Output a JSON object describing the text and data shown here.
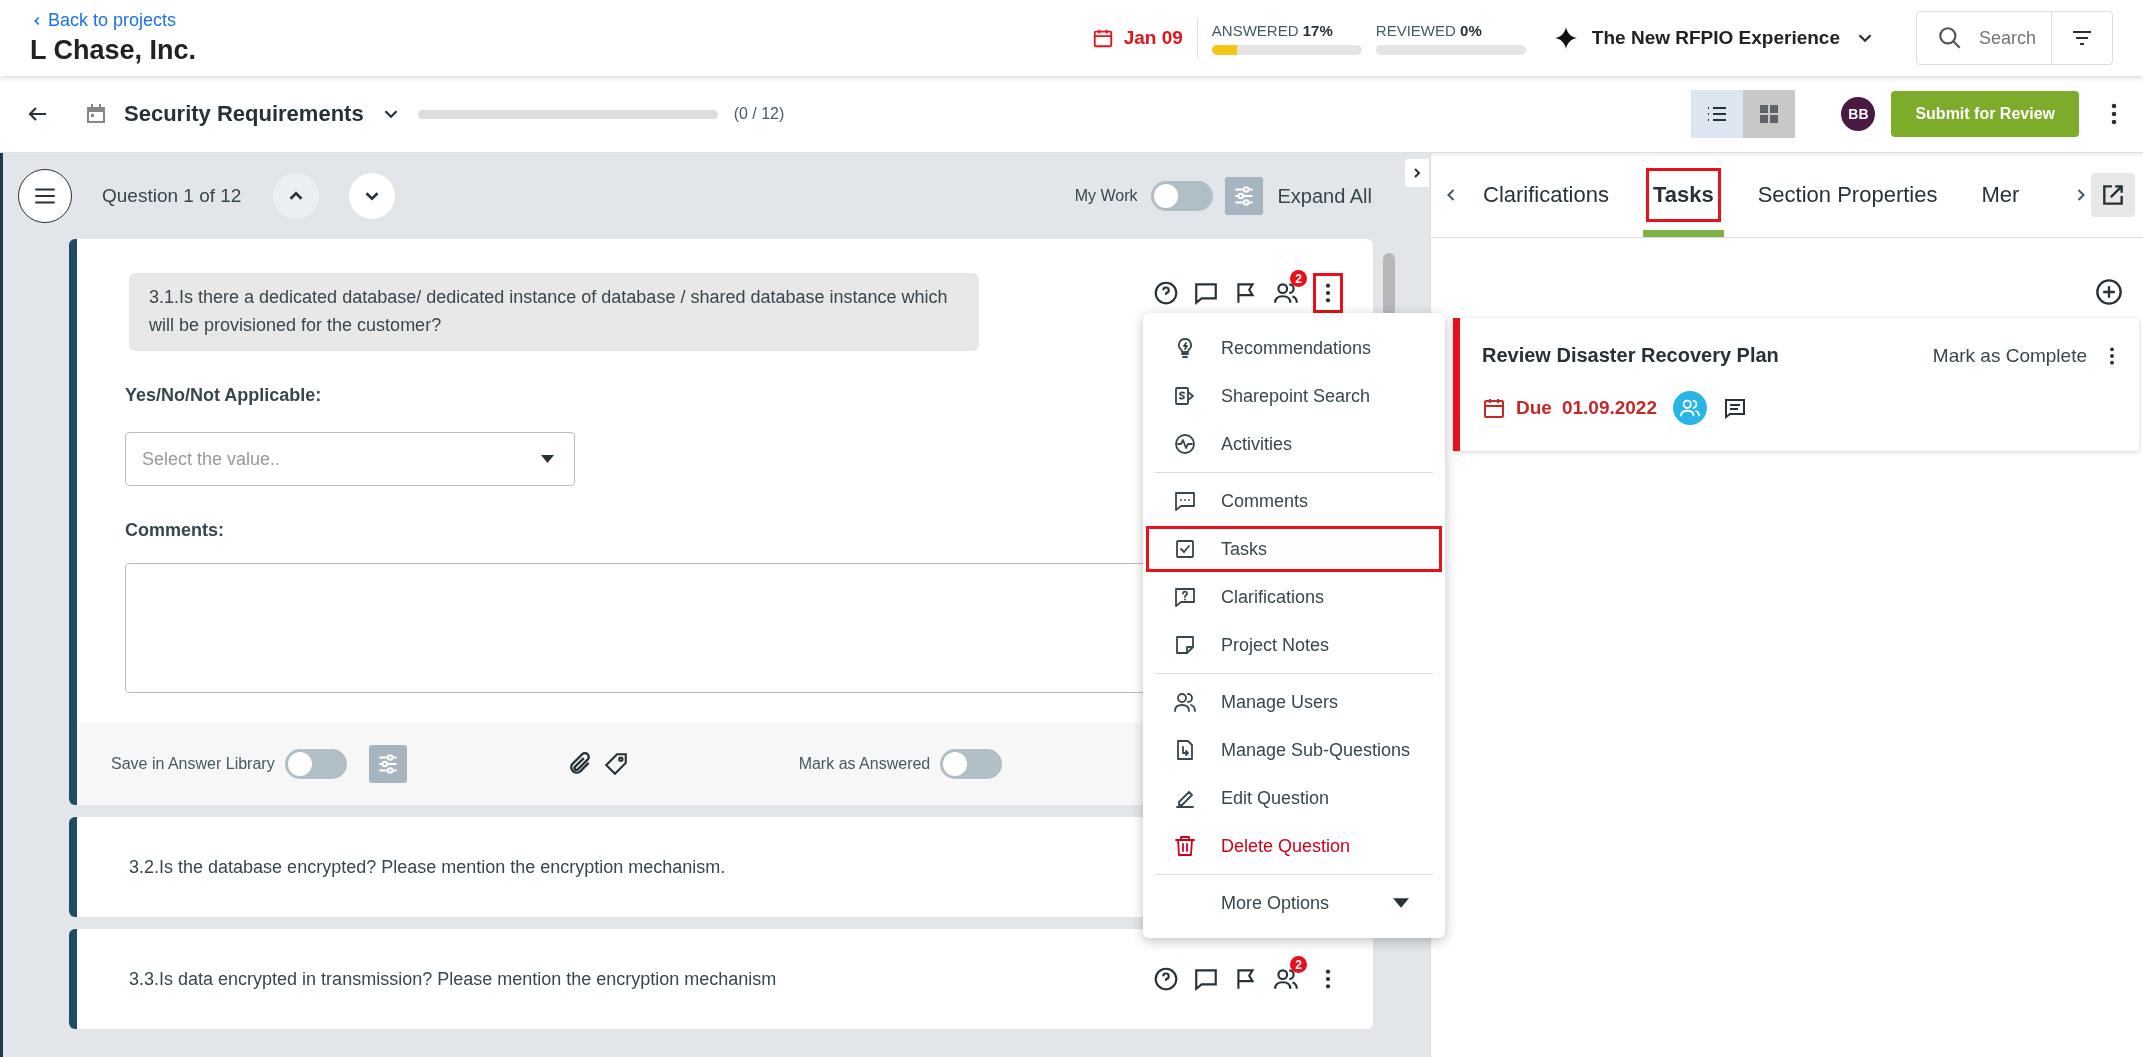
{
  "header": {
    "back_link": "Back to projects",
    "project_name": "L Chase, Inc.",
    "due_date": "Jan 09",
    "progress": [
      {
        "label": "ANSWERED",
        "value": "17%",
        "level": 0.17,
        "color": "#f5c518"
      },
      {
        "label": "REVIEWED",
        "value": "0%",
        "level": 0
      }
    ],
    "experience": "The New RFPIO Experience",
    "search": {
      "placeholder": "Search"
    }
  },
  "section_bar": {
    "title": "Security Requirements",
    "count": "(0 / 12)",
    "level": 0,
    "views": [
      {
        "kind": "list",
        "selected": true
      },
      {
        "kind": "grid",
        "selected": false
      }
    ],
    "avatar": "BB",
    "submit": "Submit for Review"
  },
  "question_nav": {
    "counter": "Question 1 of 12",
    "my_work": "My Work",
    "my_work_on": false,
    "expand_all": "Expand All"
  },
  "questions": [
    {
      "text": "3.1.Is there a dedicated database/ dedicated instance of database / shared database instance which will be provisioned for the customer?",
      "expanded": true,
      "badge": "2",
      "more_highlighted": true,
      "field_label": "Yes/No/Not Applicable:",
      "select_placeholder": "Select the value..",
      "comments_label": "Comments:",
      "save_label": "Save in Answer Library",
      "save_on": false,
      "answered_label": "Mark as Answered",
      "answered_on": false
    },
    {
      "text": "3.2.Is the database encrypted? Please mention the encryption mechanism.",
      "expanded": false
    },
    {
      "text": "3.3.Is data encrypted in transmission? Please mention the encryption mechanism",
      "expanded": false,
      "badge": "2",
      "more_highlighted": false
    }
  ],
  "menu": [
    [
      {
        "label": "Recommendations",
        "kind": "bulb",
        "highlighted": false,
        "danger": false
      },
      {
        "label": "Sharepoint Search",
        "kind": "sharepoint",
        "highlighted": false,
        "danger": false
      },
      {
        "label": "Activities",
        "kind": "pulse",
        "highlighted": false,
        "danger": false
      }
    ],
    [
      {
        "label": "Comments",
        "kind": "comment",
        "highlighted": false,
        "danger": false
      },
      {
        "label": "Tasks",
        "kind": "check",
        "highlighted": true,
        "danger": false
      },
      {
        "label": "Clarifications",
        "kind": "question",
        "highlighted": false,
        "danger": false
      },
      {
        "label": "Project Notes",
        "kind": "note",
        "highlighted": false,
        "danger": false
      }
    ],
    [
      {
        "label": "Manage Users",
        "kind": "users",
        "highlighted": false,
        "danger": false
      },
      {
        "label": "Manage Sub-Questions",
        "kind": "subq",
        "highlighted": false,
        "danger": false
      },
      {
        "label": "Edit Question",
        "kind": "edit",
        "highlighted": false,
        "danger": false
      },
      {
        "label": "Delete Question",
        "kind": "trash",
        "highlighted": false,
        "danger": true
      }
    ],
    [
      {
        "label": "More Options",
        "kind": "more",
        "highlighted": false,
        "danger": false
      }
    ]
  ],
  "side_panel": {
    "tabs": [
      {
        "label": "Clarifications",
        "selected": false,
        "highlighted": false
      },
      {
        "label": "Tasks",
        "selected": true,
        "highlighted": true
      },
      {
        "label": "Section Properties",
        "selected": false,
        "highlighted": false
      },
      {
        "label": "Mer",
        "selected": false,
        "highlighted": false
      }
    ],
    "tasks": [
      {
        "title": "Review Disaster Recovery Plan",
        "action": "Mark as Complete",
        "due_label": "Due",
        "due_date": "01.09.2022",
        "color": "#e8101a"
      }
    ]
  }
}
